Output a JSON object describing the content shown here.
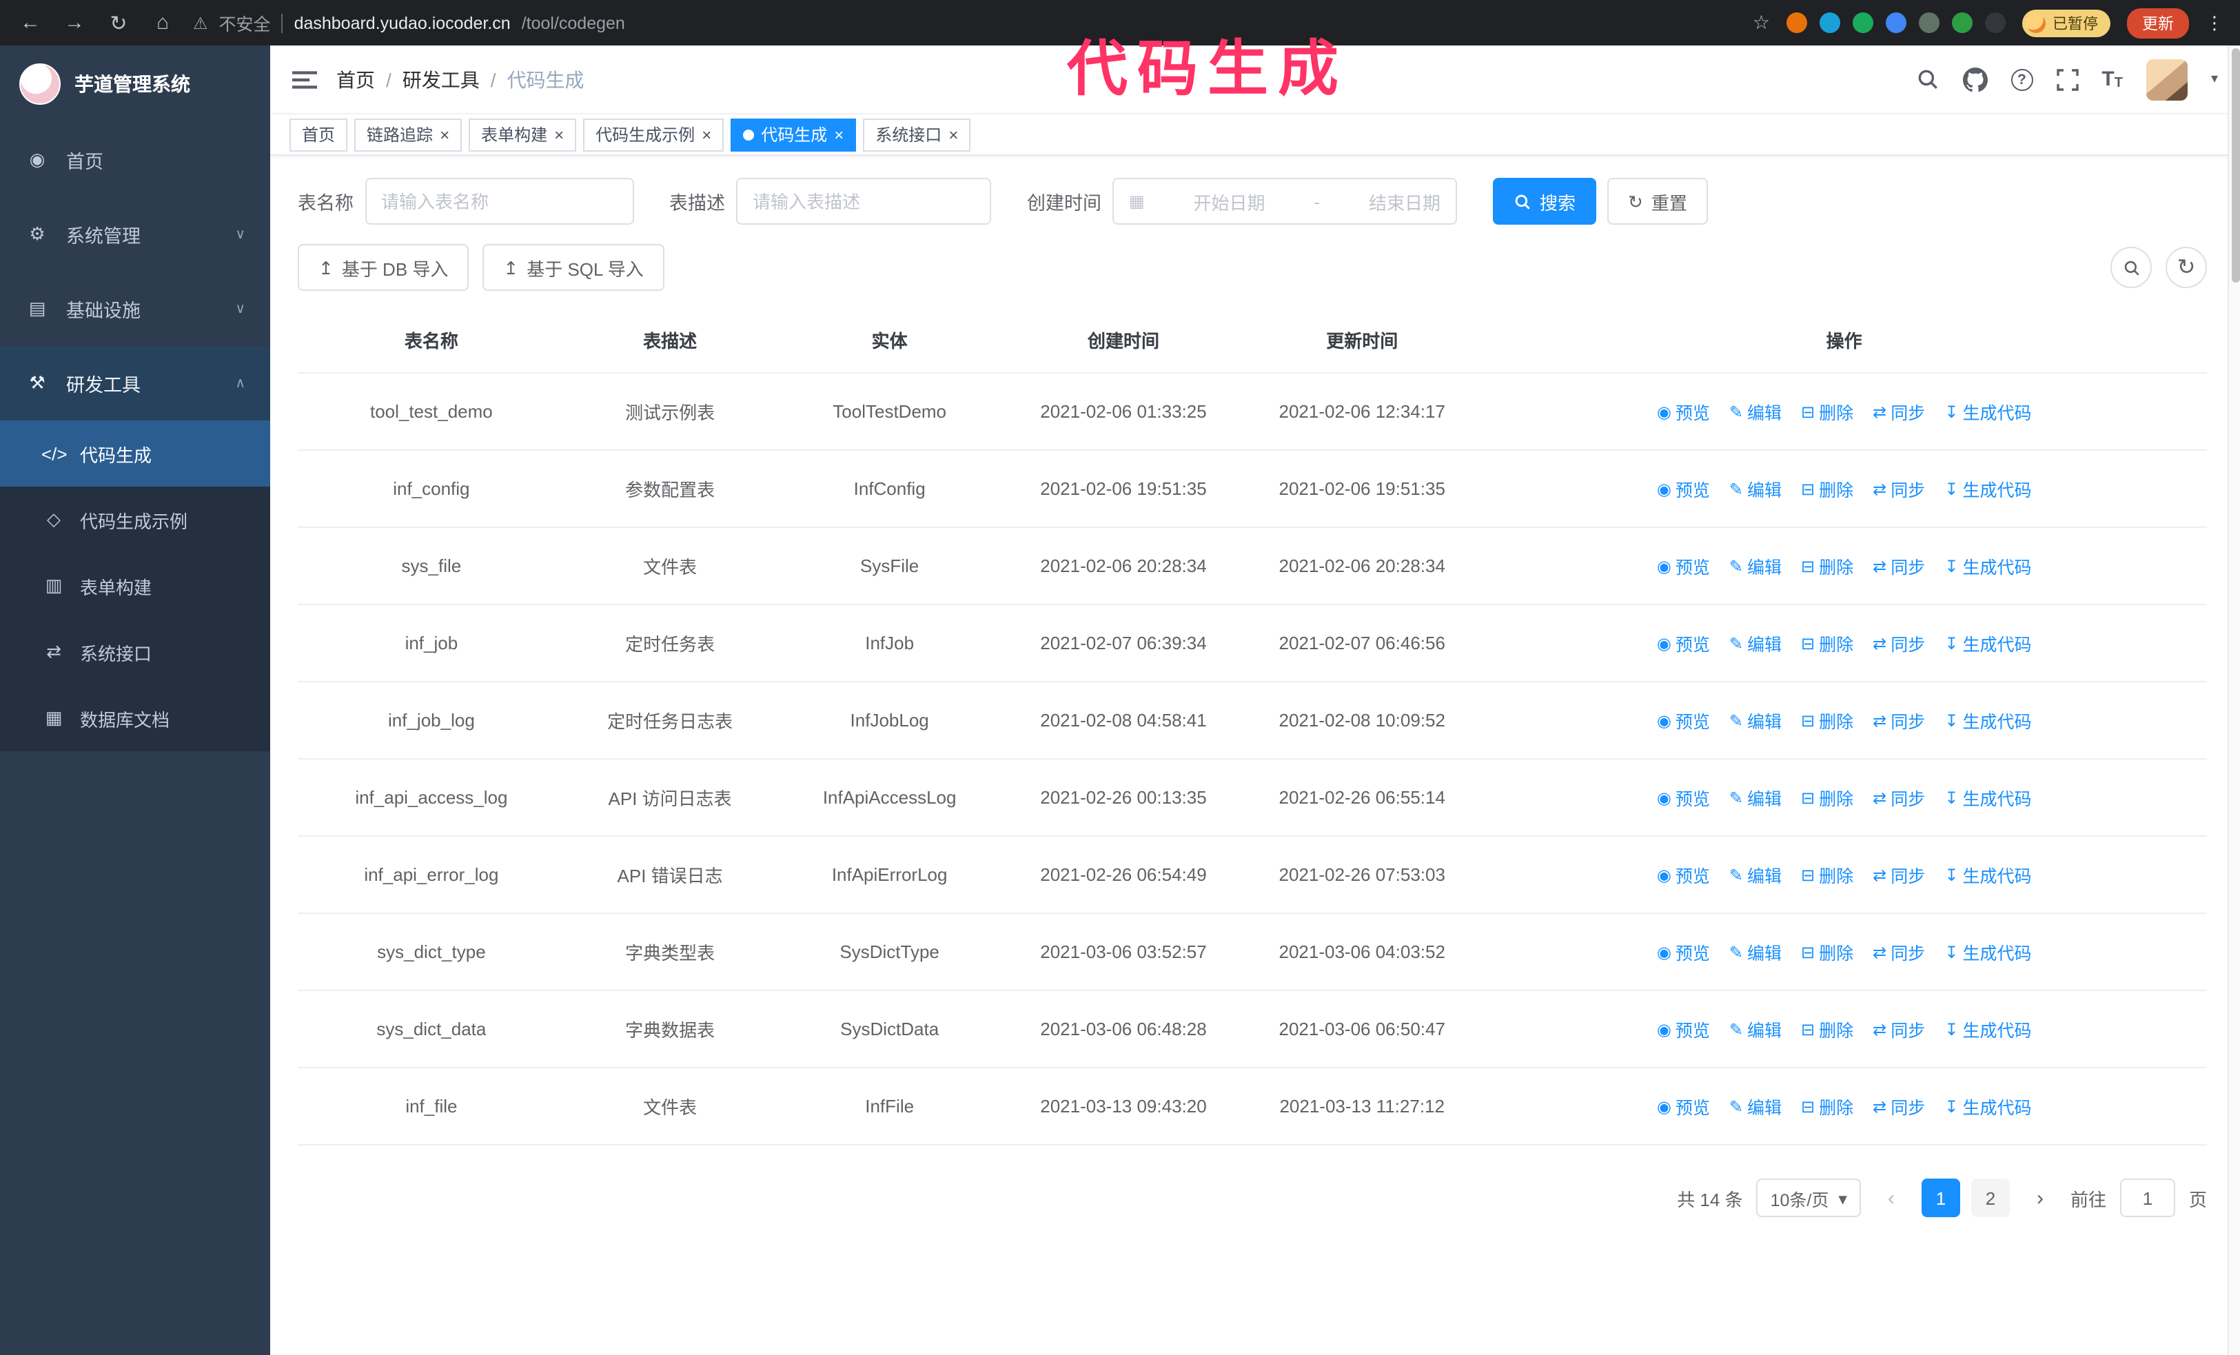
{
  "colors": {
    "primary": "#1890ff",
    "annotation": "#ff3366"
  },
  "annotation": "代码生成",
  "browser": {
    "security_label": "不安全",
    "url_host": "dashboard.yudao.iocoder.cn",
    "url_path": "/tool/codegen",
    "paused_badge": "已暂停",
    "update_label": "更新",
    "extensions": [
      {
        "id": "ext-1",
        "color": "#e8710a"
      },
      {
        "id": "ext-2",
        "color": "#1a9fd9"
      },
      {
        "id": "ext-3",
        "color": "#1aab5c"
      },
      {
        "id": "ext-4",
        "color": "#4285f4"
      },
      {
        "id": "ext-5",
        "color": "#5f7367"
      },
      {
        "id": "ext-6",
        "color": "#2e9e44"
      },
      {
        "id": "ext-7",
        "color": "#33363a"
      }
    ]
  },
  "icons": {
    "back": "←",
    "forward": "→",
    "reload": "↻",
    "home": "⌂",
    "warning": "⚠",
    "star": "☆",
    "kebab": "⋮",
    "close": "×",
    "help": "?",
    "caret_down": "▾",
    "chevron_down": "∨",
    "chevron_up": "∧",
    "calendar": "▦",
    "refresh": "↻",
    "upload": "↥",
    "prev": "‹",
    "next": "›",
    "dashboard": "◉",
    "gear": "⚙",
    "infra": "▤",
    "tools": "⚒",
    "code": "</>",
    "demo": "◇",
    "form": "▥",
    "api": "⇄",
    "dbdoc": "▦",
    "eye": "◉",
    "edit": "✎",
    "trash": "⊟",
    "sync": "⇄",
    "download": "↧",
    "text_size": "T"
  },
  "sidebar": {
    "logo_title": "芋道管理系统",
    "items": [
      {
        "id": "home",
        "label": "首页",
        "icon": "dashboard"
      },
      {
        "id": "system",
        "label": "系统管理",
        "icon": "gear",
        "chevron": "down"
      },
      {
        "id": "infra",
        "label": "基础设施",
        "icon": "infra",
        "chevron": "down"
      },
      {
        "id": "devtools",
        "label": "研发工具",
        "icon": "tools",
        "chevron": "up",
        "expanded": true,
        "submenu": [
          {
            "id": "codegen",
            "label": "代码生成",
            "icon": "code",
            "active": true
          },
          {
            "id": "codegen-demo",
            "label": "代码生成示例",
            "icon": "demo"
          },
          {
            "id": "form-builder",
            "label": "表单构建",
            "icon": "form"
          },
          {
            "id": "api",
            "label": "系统接口",
            "icon": "api"
          },
          {
            "id": "db-doc",
            "label": "数据库文档",
            "icon": "dbdoc"
          }
        ]
      }
    ]
  },
  "header": {
    "breadcrumb": [
      "首页",
      "研发工具",
      "代码生成"
    ],
    "breadcrumb_separator": "/"
  },
  "tabs": [
    {
      "id": "home",
      "label": "首页",
      "closable": false
    },
    {
      "id": "tracing",
      "label": "链路追踪",
      "closable": true
    },
    {
      "id": "form-builder",
      "label": "表单构建",
      "closable": true
    },
    {
      "id": "codegen-demo",
      "label": "代码生成示例",
      "closable": true
    },
    {
      "id": "codegen",
      "label": "代码生成",
      "closable": true,
      "active": true
    },
    {
      "id": "api",
      "label": "系统接口",
      "closable": true
    }
  ],
  "filters": {
    "table_name_label": "表名称",
    "table_name_placeholder": "请输入表名称",
    "table_desc_label": "表描述",
    "table_desc_placeholder": "请输入表描述",
    "create_time_label": "创建时间",
    "start_date_placeholder": "开始日期",
    "range_separator": "-",
    "end_date_placeholder": "结束日期",
    "search_button": "搜索",
    "reset_button": "重置"
  },
  "toolbar": {
    "import_db_label": "基于 DB 导入",
    "import_sql_label": "基于 SQL 导入"
  },
  "table": {
    "columns": [
      "表名称",
      "表描述",
      "实体",
      "创建时间",
      "更新时间",
      "操作"
    ],
    "actions": [
      {
        "id": "preview",
        "label": "预览",
        "icon": "eye"
      },
      {
        "id": "edit",
        "label": "编辑",
        "icon": "edit"
      },
      {
        "id": "delete",
        "label": "删除",
        "icon": "trash"
      },
      {
        "id": "sync",
        "label": "同步",
        "icon": "sync"
      },
      {
        "id": "generate",
        "label": "生成代码",
        "icon": "download"
      }
    ],
    "rows": [
      {
        "name": "tool_test_demo",
        "desc": "测试示例表",
        "entity": "ToolTestDemo",
        "created": "2021-02-06 01:33:25",
        "updated": "2021-02-06 12:34:17"
      },
      {
        "name": "inf_config",
        "desc": "参数配置表",
        "entity": "InfConfig",
        "created": "2021-02-06 19:51:35",
        "updated": "2021-02-06 19:51:35"
      },
      {
        "name": "sys_file",
        "desc": "文件表",
        "entity": "SysFile",
        "created": "2021-02-06 20:28:34",
        "updated": "2021-02-06 20:28:34"
      },
      {
        "name": "inf_job",
        "desc": "定时任务表",
        "entity": "InfJob",
        "created": "2021-02-07 06:39:34",
        "updated": "2021-02-07 06:46:56"
      },
      {
        "name": "inf_job_log",
        "desc": "定时任务日志表",
        "entity": "InfJobLog",
        "created": "2021-02-08 04:58:41",
        "updated": "2021-02-08 10:09:52"
      },
      {
        "name": "inf_api_access_log",
        "desc": "API 访问日志表",
        "entity": "InfApiAccessLog",
        "created": "2021-02-26 00:13:35",
        "updated": "2021-02-26 06:55:14"
      },
      {
        "name": "inf_api_error_log",
        "desc": "API 错误日志",
        "entity": "InfApiErrorLog",
        "created": "2021-02-26 06:54:49",
        "updated": "2021-02-26 07:53:03"
      },
      {
        "name": "sys_dict_type",
        "desc": "字典类型表",
        "entity": "SysDictType",
        "created": "2021-03-06 03:52:57",
        "updated": "2021-03-06 04:03:52"
      },
      {
        "name": "sys_dict_data",
        "desc": "字典数据表",
        "entity": "SysDictData",
        "created": "2021-03-06 06:48:28",
        "updated": "2021-03-06 06:50:47"
      },
      {
        "name": "inf_file",
        "desc": "文件表",
        "entity": "InfFile",
        "created": "2021-03-13 09:43:20",
        "updated": "2021-03-13 11:27:12"
      }
    ]
  },
  "pagination": {
    "total_label": "共 14 条",
    "page_size_label": "10条/页",
    "pages": [
      "1",
      "2"
    ],
    "active_page": "1",
    "goto_prefix": "前往",
    "goto_value": "1",
    "goto_suffix": "页"
  }
}
